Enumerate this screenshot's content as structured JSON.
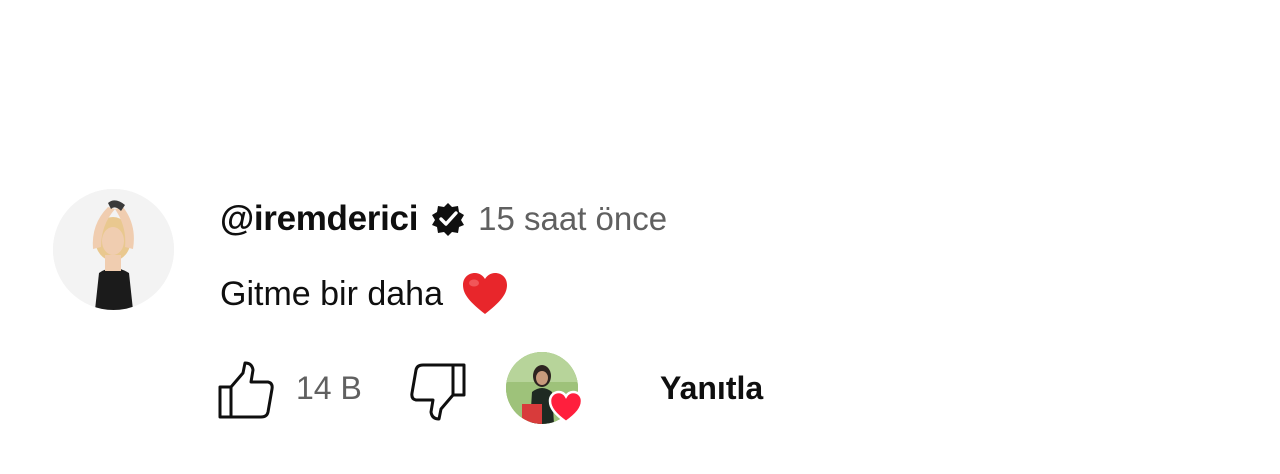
{
  "comment": {
    "author": "@iremderici",
    "verified_icon": "verified-badge-icon",
    "time": "15 saat önce",
    "text": "Gitme bir daha",
    "text_emoji": "red-heart-emoji",
    "like_count": "14 B",
    "reply_label": "Yanıtla"
  },
  "colors": {
    "text_primary": "#0f0f0f",
    "text_secondary": "#606060",
    "heart_red": "#ff1f3d",
    "emoji_red": "#e8262b"
  }
}
